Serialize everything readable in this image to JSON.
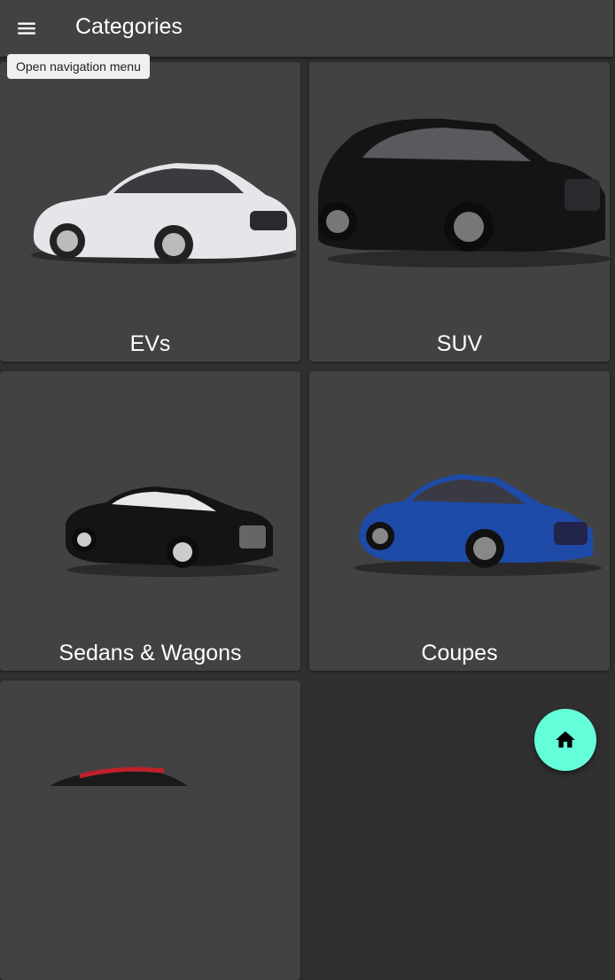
{
  "app_bar": {
    "title": "Categories",
    "menu_tooltip": "Open navigation menu"
  },
  "categories": [
    {
      "label": "EVs",
      "car_color": "#e8e8ec"
    },
    {
      "label": "SUV",
      "car_color": "#141414"
    },
    {
      "label": "Sedans & Wagons",
      "car_color": "#141414"
    },
    {
      "label": "Coupes",
      "car_color": "#1e4aa8"
    },
    {
      "label": "",
      "car_color": "#1a1a1a"
    }
  ],
  "fab": {
    "icon": "home-icon",
    "color": "#64ffda"
  }
}
